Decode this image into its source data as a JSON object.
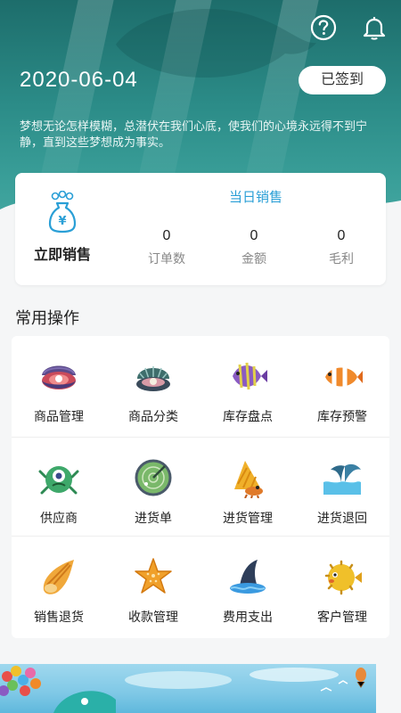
{
  "header": {
    "date": "2020-06-04",
    "signed_label": "已签到",
    "quote": "梦想无论怎样模糊，总潜伏在我们心底，使我们的心境永远得不到宁静，直到这些梦想成为事实。",
    "icons": [
      "help-icon",
      "bell-icon"
    ]
  },
  "sales": {
    "sell_now_label": "立即销售",
    "today_title": "当日销售",
    "stats": [
      {
        "value": "0",
        "label": "订单数"
      },
      {
        "value": "0",
        "label": "金额"
      },
      {
        "value": "0",
        "label": "毛利"
      }
    ]
  },
  "common_ops": {
    "title": "常用操作",
    "items": [
      {
        "label": "商品管理",
        "icon": "clam-icon"
      },
      {
        "label": "商品分类",
        "icon": "shell-pearl-icon"
      },
      {
        "label": "库存盘点",
        "icon": "angelfish-icon"
      },
      {
        "label": "库存预警",
        "icon": "clownfish-icon"
      },
      {
        "label": "供应商",
        "icon": "green-monster-icon"
      },
      {
        "label": "进货单",
        "icon": "radar-icon"
      },
      {
        "label": "进货管理",
        "icon": "hermit-crab-icon"
      },
      {
        "label": "进货退回",
        "icon": "whale-tail-icon"
      },
      {
        "label": "销售退货",
        "icon": "conch-icon"
      },
      {
        "label": "收款管理",
        "icon": "starfish-icon"
      },
      {
        "label": "费用支出",
        "icon": "shark-fin-icon"
      },
      {
        "label": "客户管理",
        "icon": "pufferfish-icon"
      }
    ]
  },
  "colors": {
    "accent": "#2a9fd6",
    "hero": "#2b8b87"
  }
}
